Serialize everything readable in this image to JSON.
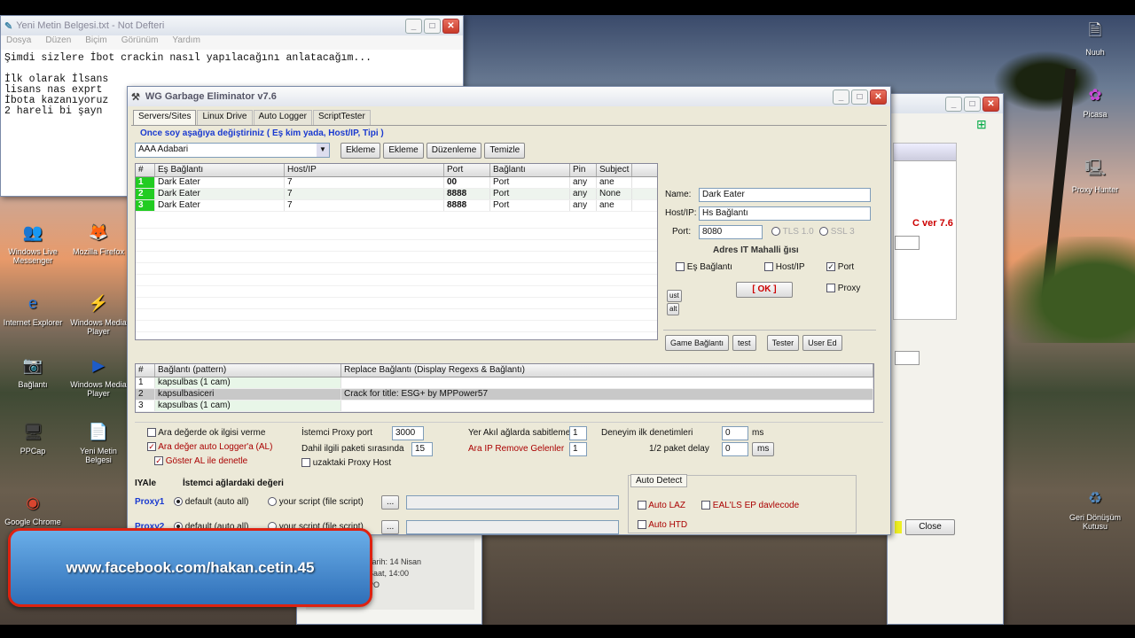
{
  "notepad": {
    "title": "Yeni Metin Belgesi.txt - Not Defteri",
    "menu": [
      "Dosya",
      "Düzen",
      "Biçim",
      "Görünüm",
      "Yardım"
    ],
    "lines": [
      "Şimdi sizlere İbot crackin nasıl yapılacağını anlatacağım...",
      "",
      "İlk olarak İlsans",
      "lisans nas exprt",
      "İbota kazanıyoruz",
      "2 hareli bi şayn"
    ]
  },
  "main": {
    "title": "WG Garbage Eliminator v7.6",
    "tabs": [
      "Servers/Sites",
      "Linux Drive",
      "Auto Logger",
      "ScriptTester"
    ],
    "hint": "Once soy aşağıya değiştiriniz ( Eş kim yada, Host/IP, Tipi )",
    "server_select": "AAA Adabari",
    "toolbar": [
      "Ekleme",
      "Ekleme",
      "Düzenleme",
      "Temizle"
    ],
    "server_columns": [
      "#",
      "Eş Bağlantı",
      "Host/IP",
      "Port",
      "Bağlantı",
      "Pin",
      "Subject"
    ],
    "servers": [
      {
        "n": "1",
        "name": "Dark Eater",
        "host": "7",
        "port": "00",
        "conn": "Port",
        "pin": "any",
        "subj": "ane"
      },
      {
        "n": "2",
        "name": "Dark Eater",
        "host": "7",
        "port": "8888",
        "conn": "Port",
        "pin": "any",
        "subj": "None"
      },
      {
        "n": "3",
        "name": "Dark Eater",
        "host": "7",
        "port": "8888",
        "conn": "Port",
        "pin": "any",
        "subj": "ane"
      }
    ],
    "side": {
      "name_label": "Name:",
      "name_value": "Dark Eater",
      "host_label": "Host/IP:",
      "host_value": "Hs Bağlantı",
      "port_label": "Port:",
      "port_value": "8080",
      "opt1": "TLS 1.0",
      "opt2": "SSL 3",
      "section": "Adres IT Mahalli ğısı",
      "chk_a": "Eş Bağlantı",
      "chk_b": "Host/IP",
      "chk_c": "Port",
      "ok": "[ OK ]",
      "proxy": "Proxy",
      "up": "ust",
      "down": "alt",
      "btn_a": "Game Bağlantı",
      "btn_b": "test",
      "btn_c": "Tester",
      "btn_d": "User Ed"
    },
    "rule_columns": [
      "#",
      "Bağlantı (pattern)",
      "Replace Bağlantı (Display Regexs & Bağlantı)"
    ],
    "rules": [
      {
        "n": "1",
        "pattern": "kapsulbas (1 cam)",
        "replace": ""
      },
      {
        "n": "2",
        "pattern": "kapsulbasiceri",
        "replace": "Crack for title: ESG+ by MPPower57"
      },
      {
        "n": "3",
        "pattern": "kapsulbas (1 cam)",
        "replace": ""
      }
    ],
    "opts": {
      "o1": "Ara değerde ok ilgisi verme",
      "o2": "Ara değer auto Logger'a (AL)",
      "o3": "Göster AL ile denetle",
      "o4": "İstemci Proxy port",
      "o4v": "3000",
      "o5": "Dahil ilgili paketi sırasında",
      "o5v": "15",
      "o6": "uzaktaki Proxy Host",
      "o7": "Yer Akıl ağlarda sabitleme",
      "o7v": "1",
      "o8": "Ara IP Remove Gelenler",
      "o8v": "1",
      "o9": "Deneyim ilk denetimleri",
      "o9v": "0",
      "o9u": "ms",
      "o10": "1/2 paket delay",
      "o10v": "0",
      "o10u": "ms"
    },
    "proxy_head_a": "IYAle",
    "proxy_head_b": "İstemci ağlardaki değeri",
    "proxies": [
      {
        "label": "Proxy1",
        "r1": "default (auto all)",
        "r2": "your script (file script)",
        "path": "..."
      },
      {
        "label": "Proxy2",
        "r1": "default (auto all)",
        "r2": "your script (file script)",
        "path": "..."
      }
    ],
    "auto_detect": {
      "tab": "Auto Detect",
      "c1": "Auto LAZ",
      "c2": "EAL'LS EP davlecode",
      "c3": "Auto HTD"
    }
  },
  "bg_window": {
    "version": "C ver 7.6",
    "close": "Close"
  },
  "behind_win": {
    "lines": [
      "Tarih: 14 Nisan",
      "Saat, 14:00",
      "PO"
    ]
  },
  "desktop_icons_left": [
    {
      "name": "Windows Live Messenger",
      "glyph": "👥",
      "color": "#3a7dd8"
    },
    {
      "name": "Mozilla Firefox",
      "glyph": "🦊",
      "color": "#e2741c"
    },
    {
      "name": "Internet Explorer",
      "glyph": "e",
      "color": "#2a77d6"
    },
    {
      "name": "Windows Media Player",
      "glyph": "⚡",
      "color": "#2a4fb0"
    },
    {
      "name": "Bağlantı",
      "glyph": "📷",
      "color": "#555"
    },
    {
      "name": "Windows Media Player",
      "glyph": "▶",
      "color": "#1e5cc8"
    },
    {
      "name": "PPCap",
      "glyph": "🖥",
      "color": "#444"
    },
    {
      "name": "Yeni Metin Belgesi",
      "glyph": "📄",
      "color": "#ddd"
    },
    {
      "name": "Google Chrome",
      "glyph": "◉",
      "color": "#d9452f"
    }
  ],
  "desktop_icons_right": [
    {
      "name": "Nuuh",
      "glyph": "🗎",
      "color": "#ddd"
    },
    {
      "name": "Picasa",
      "glyph": "✿",
      "color": "#c84ad6"
    },
    {
      "name": "Proxy Hunter",
      "glyph": "🖳",
      "color": "#aaa"
    },
    {
      "name": "Geri Dönüşüm Kutusu",
      "glyph": "♻",
      "color": "#58b"
    }
  ],
  "banner": "www.facebook.com/hakan.cetin.45"
}
